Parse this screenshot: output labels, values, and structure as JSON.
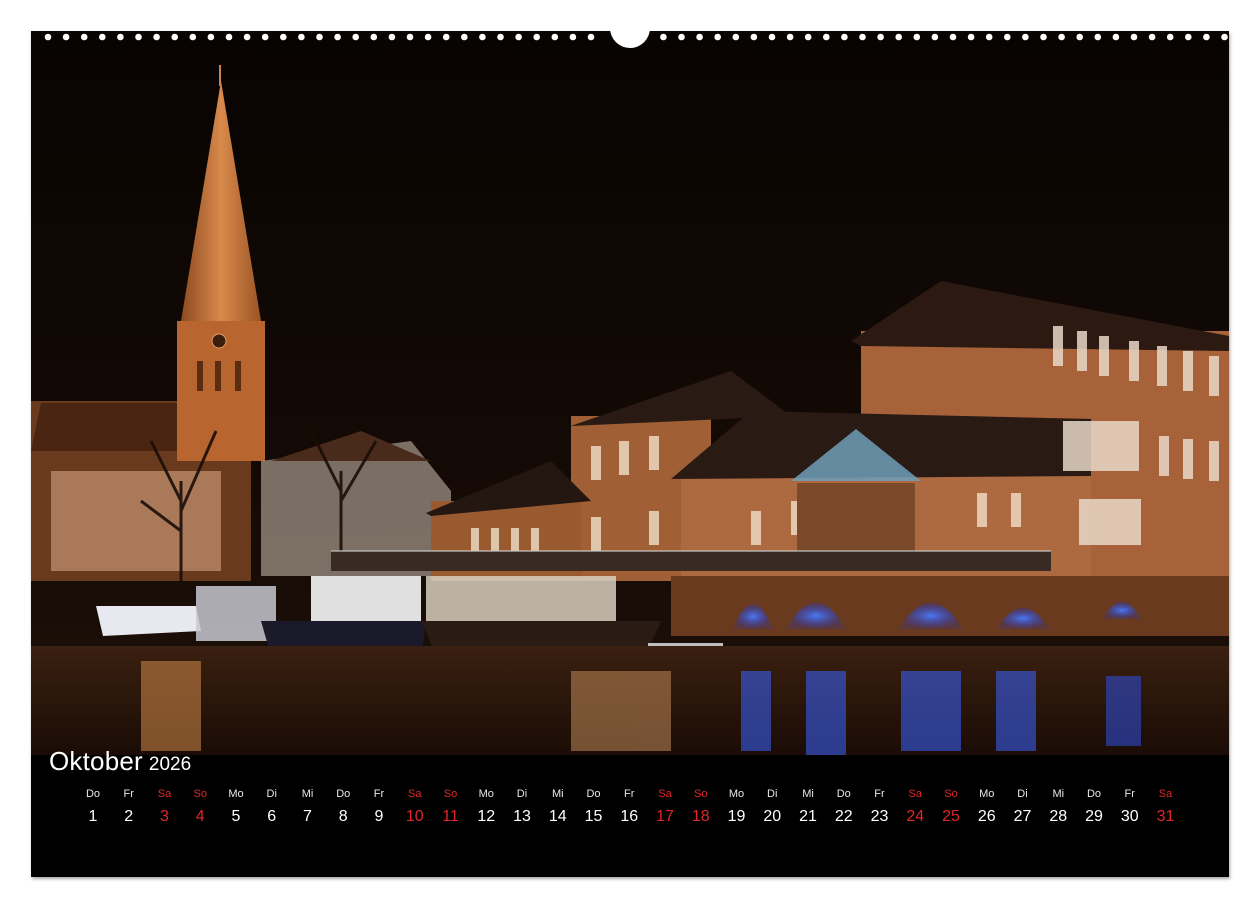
{
  "calendar": {
    "month": "Oktober",
    "year": "2026",
    "weekend_color": "#e0262b",
    "days": [
      {
        "dow": "Do",
        "num": "1",
        "weekend": false
      },
      {
        "dow": "Fr",
        "num": "2",
        "weekend": false
      },
      {
        "dow": "Sa",
        "num": "3",
        "weekend": true
      },
      {
        "dow": "So",
        "num": "4",
        "weekend": true
      },
      {
        "dow": "Mo",
        "num": "5",
        "weekend": false
      },
      {
        "dow": "Di",
        "num": "6",
        "weekend": false
      },
      {
        "dow": "Mi",
        "num": "7",
        "weekend": false
      },
      {
        "dow": "Do",
        "num": "8",
        "weekend": false
      },
      {
        "dow": "Fr",
        "num": "9",
        "weekend": false
      },
      {
        "dow": "Sa",
        "num": "10",
        "weekend": true
      },
      {
        "dow": "So",
        "num": "11",
        "weekend": true
      },
      {
        "dow": "Mo",
        "num": "12",
        "weekend": false
      },
      {
        "dow": "Di",
        "num": "13",
        "weekend": false
      },
      {
        "dow": "Mi",
        "num": "14",
        "weekend": false
      },
      {
        "dow": "Do",
        "num": "15",
        "weekend": false
      },
      {
        "dow": "Fr",
        "num": "16",
        "weekend": false
      },
      {
        "dow": "Sa",
        "num": "17",
        "weekend": true
      },
      {
        "dow": "So",
        "num": "18",
        "weekend": true
      },
      {
        "dow": "Mo",
        "num": "19",
        "weekend": false
      },
      {
        "dow": "Di",
        "num": "20",
        "weekend": false
      },
      {
        "dow": "Mi",
        "num": "21",
        "weekend": false
      },
      {
        "dow": "Do",
        "num": "22",
        "weekend": false
      },
      {
        "dow": "Fr",
        "num": "23",
        "weekend": false
      },
      {
        "dow": "Sa",
        "num": "24",
        "weekend": true
      },
      {
        "dow": "So",
        "num": "25",
        "weekend": true
      },
      {
        "dow": "Mo",
        "num": "26",
        "weekend": false
      },
      {
        "dow": "Di",
        "num": "27",
        "weekend": false
      },
      {
        "dow": "Mi",
        "num": "28",
        "weekend": false
      },
      {
        "dow": "Do",
        "num": "29",
        "weekend": false
      },
      {
        "dow": "Fr",
        "num": "30",
        "weekend": false
      },
      {
        "dow": "Sa",
        "num": "31",
        "weekend": true
      }
    ]
  },
  "photo": {
    "colors": {
      "sky": "#0b0603",
      "brick": "#b06a3c",
      "water": "#2a1608",
      "blue_light": "#2a56ff",
      "warm_light": "#ffb066"
    }
  }
}
